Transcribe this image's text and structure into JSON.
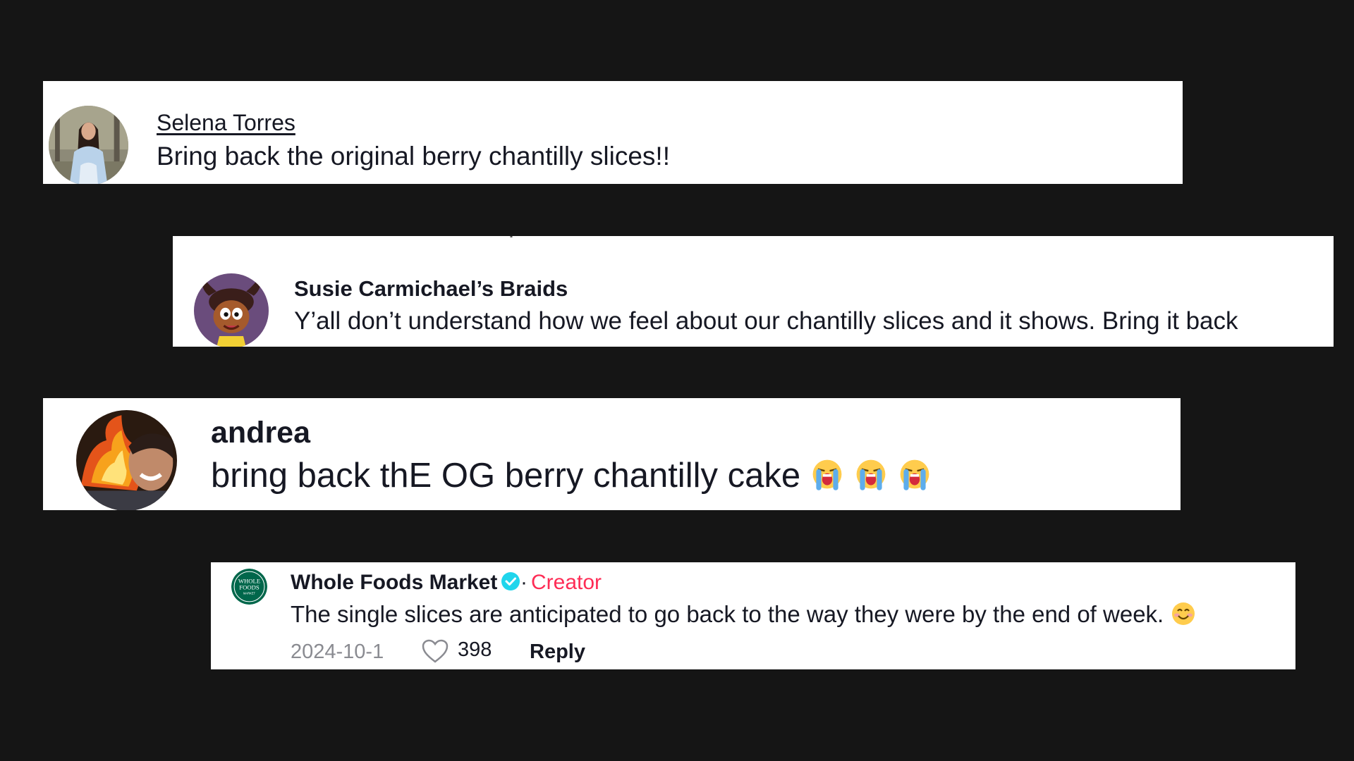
{
  "comments": [
    {
      "username": "Selena Torres",
      "text": "Bring back the original berry chantilly slices!!",
      "avatar_icon": "user-photo-avatar"
    },
    {
      "username": "Susie Carmichael’s Braids",
      "text": "Y’all don’t understand how we feel about our chantilly slices and it shows. Bring it back",
      "avatar_icon": "cartoon-character-avatar"
    },
    {
      "username": "andrea",
      "text": "bring back thE OG berry chantilly cake",
      "emojis": [
        "loudly-crying-face",
        "loudly-crying-face",
        "loudly-crying-face"
      ],
      "avatar_icon": "fire-photo-avatar"
    },
    {
      "username": "Whole Foods Market",
      "verified": true,
      "separator": "·",
      "badge": "Creator",
      "text": "The single slices are anticipated to go back to the way they were by the end of week.",
      "emoji": "smiling-face",
      "date": "2024-10-1",
      "likes": "398",
      "reply_label": "Reply",
      "avatar_icon": "whole-foods-logo-avatar",
      "avatar_logo_text": [
        "WHOLE",
        "FOODS",
        "MARKET"
      ]
    }
  ],
  "colors": {
    "background": "#151515",
    "card": "#ffffff",
    "text": "#161823",
    "creator_badge": "#fe2c55",
    "verified": "#20d5ec",
    "meta": "#8a8b91",
    "wfm_green": "#00674b"
  }
}
